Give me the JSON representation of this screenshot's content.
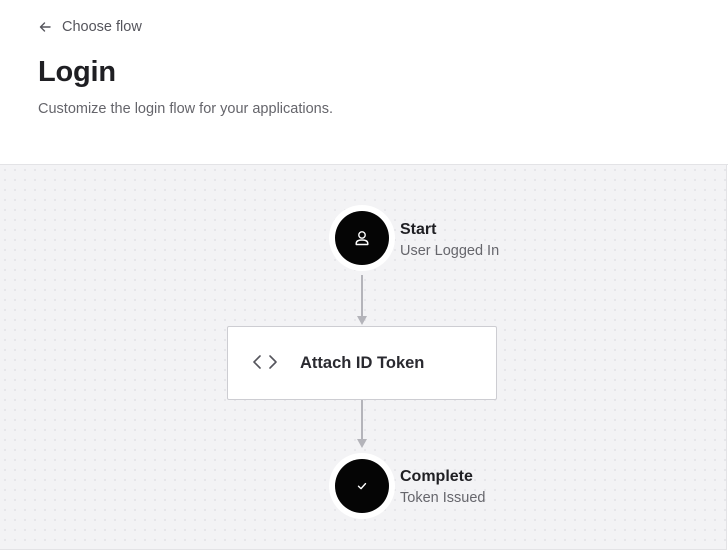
{
  "header": {
    "back_label": "Choose flow",
    "title": "Login",
    "subtitle": "Customize the login flow for your applications."
  },
  "flow": {
    "start": {
      "title": "Start",
      "subtitle": "User Logged In",
      "icon": "user-icon"
    },
    "action": {
      "label": "Attach ID Token",
      "icon": "code-icon"
    },
    "complete": {
      "title": "Complete",
      "subtitle": "Token Issued",
      "icon": "check-icon"
    }
  },
  "colors": {
    "node_fill": "#050505",
    "connector": "#b4b4ba",
    "canvas_bg": "#f3f3f5"
  }
}
